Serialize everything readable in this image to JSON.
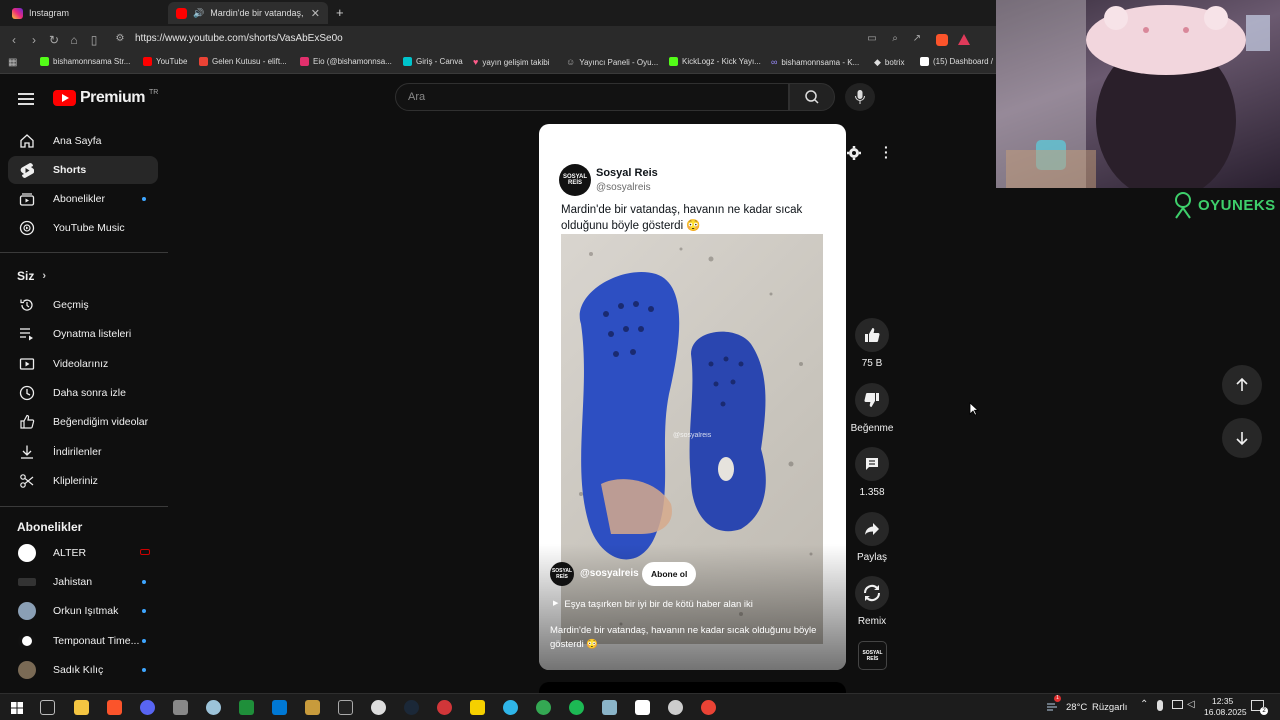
{
  "browser": {
    "tabs": [
      {
        "title": "Instagram",
        "active": false
      },
      {
        "title": "Mardin'de bir vatandaş, havan",
        "active": true
      }
    ],
    "url": "https://www.youtube.com/shorts/VasAbExSe0o",
    "bookmarks": [
      "bishamonnsama Str...",
      "YouTube",
      "Gelen Kutusu - elift...",
      "Eio (@bishamonnsa...",
      "Giriş - Canva",
      "yayın gelişim takibi",
      "Yayıncı Paneli - Oyu...",
      "KickLogz - Kick Yayı...",
      "bishamonnsama - K...",
      "botrix",
      "(15) Dashboard /"
    ]
  },
  "header": {
    "logo_text": "Premium",
    "logo_region": "TR",
    "search_placeholder": "Ara"
  },
  "sidebar": {
    "main": [
      {
        "label": "Ana Sayfa",
        "icon": "home-icon"
      },
      {
        "label": "Shorts",
        "icon": "shorts-icon",
        "active": true
      },
      {
        "label": "Abonelikler",
        "icon": "subscriptions-icon",
        "dot": true
      },
      {
        "label": "YouTube Music",
        "icon": "music-icon"
      }
    ],
    "you_title": "Siz",
    "you": [
      {
        "label": "Geçmiş",
        "icon": "history-icon"
      },
      {
        "label": "Oynatma listeleri",
        "icon": "playlist-icon"
      },
      {
        "label": "Videolarınız",
        "icon": "your-videos-icon"
      },
      {
        "label": "Daha sonra izle",
        "icon": "clock-icon"
      },
      {
        "label": "Beğendiğim videolar",
        "icon": "thumbs-up-icon"
      },
      {
        "label": "İndirilenler",
        "icon": "download-icon"
      },
      {
        "label": "Klipleriniz",
        "icon": "scissors-icon"
      }
    ],
    "subs_title": "Abonelikler",
    "subs": [
      {
        "label": "ALTER",
        "live": true
      },
      {
        "label": "Jahistan",
        "dot": true
      },
      {
        "label": "Orkun Işıtmak",
        "dot": true
      },
      {
        "label": "Temponaut Time...",
        "dot": true
      },
      {
        "label": "Sadık Kılıç",
        "dot": true
      }
    ]
  },
  "short": {
    "tweet_name": "Sosyal Reis",
    "tweet_handle": "@sosyalreis",
    "tweet_text": "Mardin'de bir vatandaş, havanın ne kadar sıcak olduğunu böyle gösterdi 😳",
    "watermark": "@sosyalreis",
    "channel": "@sosyalreis",
    "subscribe_label": "Abone ol",
    "related_link": "Eşya taşırken bir iyi bir de kötü haber alan iki",
    "caption": "Mardin'de bir vatandaş, havanın ne kadar sıcak olduğunu böyle gösterdi 😳",
    "avatar_text": "SOSYAL REİS"
  },
  "actions": {
    "like_count": "75 B",
    "dislike_label": "Beğenme",
    "comment_count": "1.358",
    "share_label": "Paylaş",
    "remix_label": "Remix"
  },
  "overlay": {
    "brand": "OYUNEKS"
  },
  "taskbar": {
    "weather_temp": "28°C",
    "weather_text": "Rüzgarlı",
    "time": "12:35",
    "date": "16.08.2025",
    "weather_badge": "1",
    "notification_count": "2"
  }
}
